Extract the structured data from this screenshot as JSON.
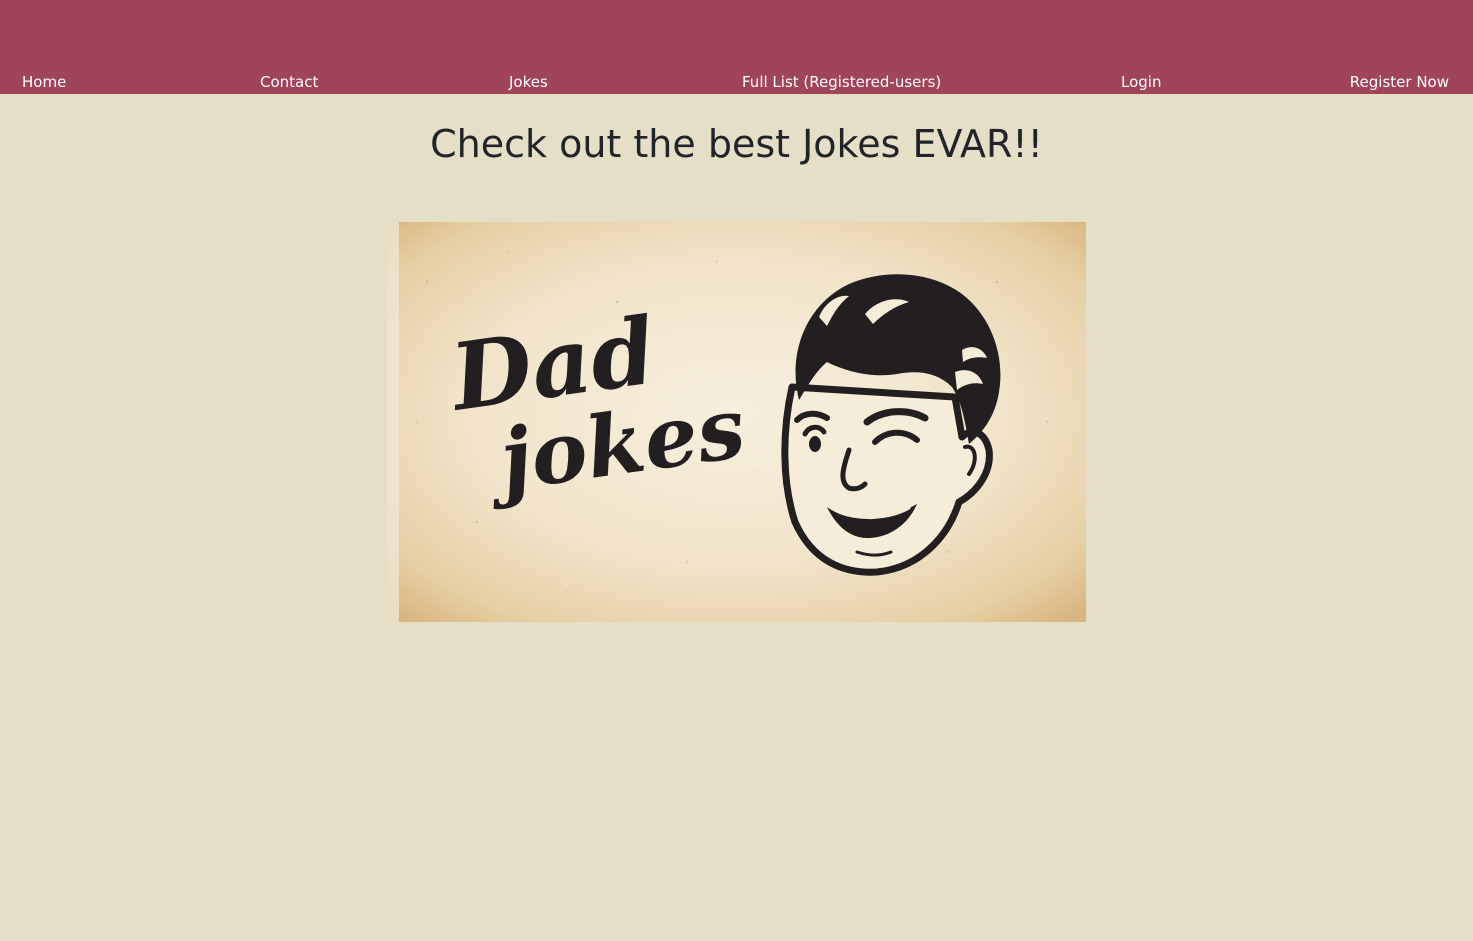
{
  "nav": {
    "home": "Home",
    "contact": "Contact",
    "jokes": "Jokes",
    "full_list": "Full List (Registered-users)",
    "login": "Login",
    "register": "Register Now"
  },
  "main": {
    "heading": "Check out the best Jokes EVAR!!",
    "hero_image": {
      "text_line1": "Dad",
      "text_line2": "jokes",
      "icon": "winking-man-icon"
    }
  },
  "colors": {
    "navbar": "#a04459",
    "page_background": "#e5dfc8",
    "heading_text": "#212529",
    "nav_text": "#ffffff",
    "ink": "#231f20",
    "paper": "#f3e8d2"
  }
}
